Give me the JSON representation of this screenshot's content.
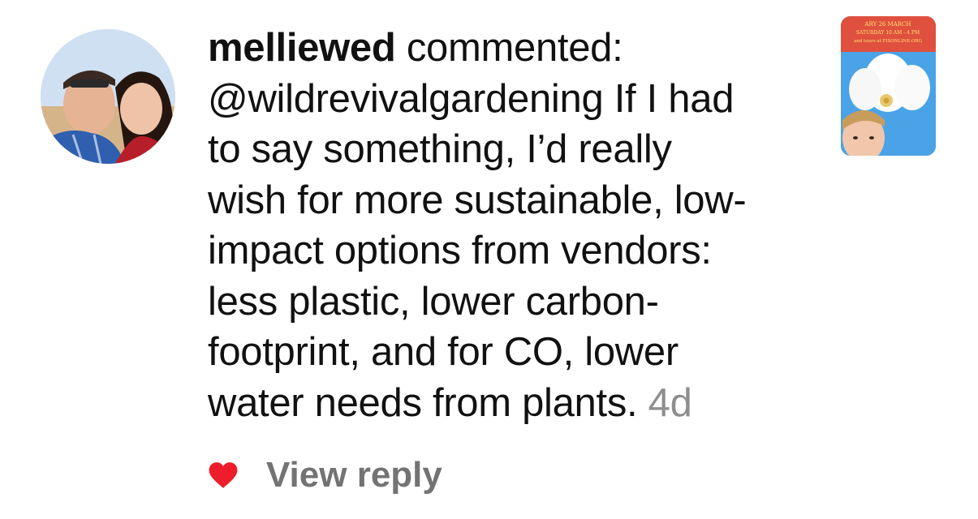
{
  "comment": {
    "username": "melliewed",
    "action": " commented:",
    "lines": [
      "@wildrevivalgardening If I had",
      "to say something, I’d really",
      "wish for more sustainable, low-",
      "impact options from vendors:",
      "less plastic, lower carbon-",
      "footprint, and for CO, lower",
      "water needs from plants. "
    ],
    "time": "4d"
  },
  "actions": {
    "view_reply_label": "View reply",
    "like_icon": "heart-icon",
    "like_color": "#ed1d2b"
  },
  "thumbnail": {
    "header_lines": [
      "ARY 26 MARCH",
      "SATURDAY 10 AM - 4 PM",
      "and tours at FISONLINE.ORG"
    ]
  }
}
